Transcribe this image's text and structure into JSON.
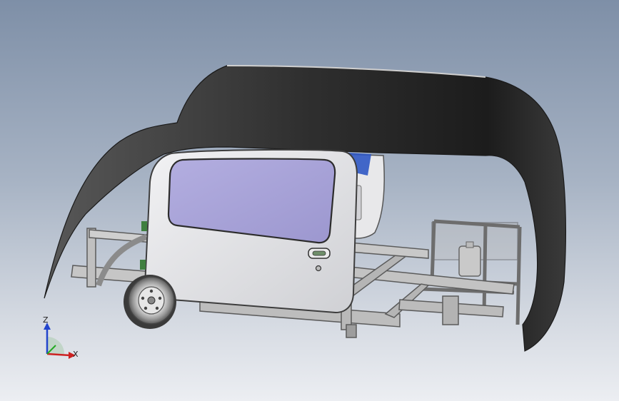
{
  "triad": {
    "z_label": "Z",
    "x_label": "X"
  },
  "colors": {
    "background_top": "#7e8fa7",
    "background_bottom": "#eceef2",
    "canopy": "#3c3c3c",
    "door": "#e3e3e6",
    "window": "#a8a3d8",
    "frame": "#8a8a8a",
    "axis_x": "#cc2222",
    "axis_y": "#22aa22",
    "axis_z": "#2244cc"
  },
  "icons": [
    "triad-icon",
    "door-handle-icon",
    "wheel-icon"
  ]
}
